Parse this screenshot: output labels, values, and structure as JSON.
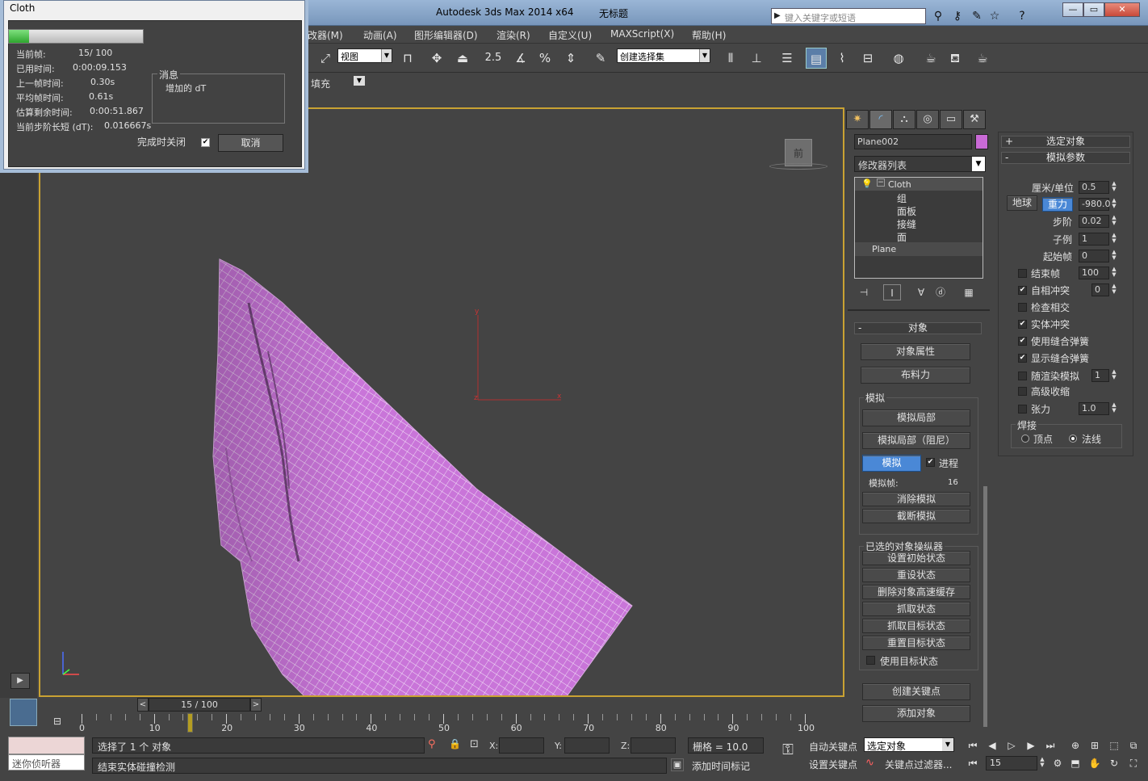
{
  "titlebar": {
    "app_title": "Autodesk 3ds Max  2014 x64",
    "doc_title": "无标题",
    "search_placeholder": "键入关键字或短语"
  },
  "menubar": {
    "items": [
      "改器(M)",
      "动画(A)",
      "图形编辑器(D)",
      "渲染(R)",
      "自定义(U)",
      "MAXScript(X)",
      "帮助(H)"
    ]
  },
  "toolbar": {
    "view_combo": "视图",
    "selection_set_combo": "创建选择集",
    "snap_value": "2.5"
  },
  "ribbon": {
    "fill_label": "填充"
  },
  "viewport": {
    "nav_cube_face": "前",
    "axis_y": "y",
    "axis_x": "x",
    "axis_z": "z"
  },
  "cloth_dialog": {
    "title": "Cloth",
    "progress": 0.15,
    "rows": [
      {
        "label": "当前帧:",
        "value": "15/  100"
      },
      {
        "label": "已用时间:",
        "value": "0:00:09.153"
      },
      {
        "label": "上一帧时间:",
        "value": "0.30s"
      },
      {
        "label": "平均帧时间:",
        "value": "0.61s"
      },
      {
        "label": "估算剩余时间:",
        "value": "0:00:51.867"
      },
      {
        "label": "当前步阶长短 (dT):",
        "value": "0.016667s"
      }
    ],
    "message_legend": "消息",
    "message_text": "增加的 dT",
    "close_when_done_label": "完成时关闭",
    "close_when_done_checked": true,
    "cancel_label": "取消"
  },
  "command_panel": {
    "object_name": "Plane002",
    "object_color": "#c96ad6",
    "modifier_list": "修改器列表",
    "stack": {
      "cloth": "Cloth",
      "subs": [
        "组",
        "面板",
        "接缝",
        "面"
      ],
      "plane": "Plane"
    },
    "object_rollout": {
      "title": "对象",
      "object_properties": "对象属性",
      "cloth_forces": "布料力",
      "simulation_group": "模拟",
      "sim_local": "模拟局部",
      "sim_local_damped": "模拟局部（阻尼）",
      "simulate": "模拟",
      "progress_label": "进程",
      "progress_checked": true,
      "sim_frame_label": "模拟帧:",
      "sim_frame_value": "16",
      "erase_sim": "消除模拟",
      "truncate_sim": "截断模拟",
      "manip_group": "已选的对象操纵器",
      "set_initial_state": "设置初始状态",
      "reset_state": "重设状态",
      "delete_cache": "删除对象高速缓存",
      "grab_state": "抓取状态",
      "grab_target_state": "抓取目标状态",
      "reset_target_state": "重置目标状态",
      "use_target_state": "使用目标状态",
      "create_keys": "创建关键点",
      "add_objects": "添加对象"
    }
  },
  "sim_params": {
    "selected_object": "选定对象",
    "title": "模拟参数",
    "cm_per_unit_label": "厘米/单位",
    "cm_per_unit": "0.5",
    "earth": "地球",
    "gravity": "重力",
    "gravity_value": "-980.0",
    "step_label": "步阶",
    "step": "0.02",
    "subsample_label": "子例",
    "subsample": "1",
    "start_frame_label": "起始帧",
    "start_frame": "0",
    "end_frame_label": "结束帧",
    "end_frame": "100",
    "self_collision_label": "自相冲突",
    "self_collision": "0",
    "check_intersection_label": "检查相交",
    "solid_collision_label": "实体冲突",
    "use_sewing_label": "使用缝合弹簧",
    "show_sewing_label": "显示缝合弹簧",
    "render_sim_label": "随渲染模拟",
    "render_sim": "1",
    "adv_pinch_label": "高级收缩",
    "tension_label": "张力",
    "tension": "1.0",
    "weld_group": "焊接",
    "weld_vertex": "顶点",
    "weld_normal": "法线"
  },
  "timeline": {
    "slider_label": "15 / 100",
    "current_frame": 15,
    "ticks": [
      "0",
      "10",
      "20",
      "30",
      "40",
      "50",
      "60",
      "70",
      "80",
      "90",
      "100"
    ]
  },
  "status": {
    "mini_listener": "迷你侦听器",
    "line1": "选择了 1 个 对象",
    "line2": "结束实体碰撞检测",
    "x_label": "X:",
    "y_label": "Y:",
    "z_label": "Z:",
    "grid": "栅格 = 10.0",
    "add_time_tag": "添加时间标记",
    "auto_key": "自动关键点",
    "set_key": "设置关键点",
    "selected_combo": "选定对象",
    "key_filters": "关键点过滤器...",
    "frame_value": "15"
  }
}
